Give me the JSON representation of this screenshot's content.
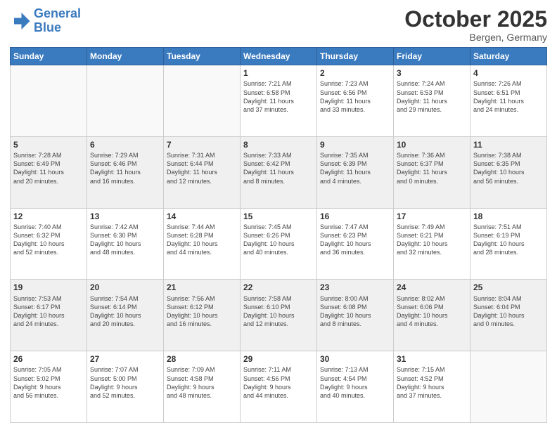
{
  "header": {
    "logo_line1": "General",
    "logo_line2": "Blue",
    "month": "October 2025",
    "location": "Bergen, Germany"
  },
  "weekdays": [
    "Sunday",
    "Monday",
    "Tuesday",
    "Wednesday",
    "Thursday",
    "Friday",
    "Saturday"
  ],
  "weeks": [
    [
      {
        "day": "",
        "info": ""
      },
      {
        "day": "",
        "info": ""
      },
      {
        "day": "",
        "info": ""
      },
      {
        "day": "1",
        "info": "Sunrise: 7:21 AM\nSunset: 6:58 PM\nDaylight: 11 hours\nand 37 minutes."
      },
      {
        "day": "2",
        "info": "Sunrise: 7:23 AM\nSunset: 6:56 PM\nDaylight: 11 hours\nand 33 minutes."
      },
      {
        "day": "3",
        "info": "Sunrise: 7:24 AM\nSunset: 6:53 PM\nDaylight: 11 hours\nand 29 minutes."
      },
      {
        "day": "4",
        "info": "Sunrise: 7:26 AM\nSunset: 6:51 PM\nDaylight: 11 hours\nand 24 minutes."
      }
    ],
    [
      {
        "day": "5",
        "info": "Sunrise: 7:28 AM\nSunset: 6:49 PM\nDaylight: 11 hours\nand 20 minutes."
      },
      {
        "day": "6",
        "info": "Sunrise: 7:29 AM\nSunset: 6:46 PM\nDaylight: 11 hours\nand 16 minutes."
      },
      {
        "day": "7",
        "info": "Sunrise: 7:31 AM\nSunset: 6:44 PM\nDaylight: 11 hours\nand 12 minutes."
      },
      {
        "day": "8",
        "info": "Sunrise: 7:33 AM\nSunset: 6:42 PM\nDaylight: 11 hours\nand 8 minutes."
      },
      {
        "day": "9",
        "info": "Sunrise: 7:35 AM\nSunset: 6:39 PM\nDaylight: 11 hours\nand 4 minutes."
      },
      {
        "day": "10",
        "info": "Sunrise: 7:36 AM\nSunset: 6:37 PM\nDaylight: 11 hours\nand 0 minutes."
      },
      {
        "day": "11",
        "info": "Sunrise: 7:38 AM\nSunset: 6:35 PM\nDaylight: 10 hours\nand 56 minutes."
      }
    ],
    [
      {
        "day": "12",
        "info": "Sunrise: 7:40 AM\nSunset: 6:32 PM\nDaylight: 10 hours\nand 52 minutes."
      },
      {
        "day": "13",
        "info": "Sunrise: 7:42 AM\nSunset: 6:30 PM\nDaylight: 10 hours\nand 48 minutes."
      },
      {
        "day": "14",
        "info": "Sunrise: 7:44 AM\nSunset: 6:28 PM\nDaylight: 10 hours\nand 44 minutes."
      },
      {
        "day": "15",
        "info": "Sunrise: 7:45 AM\nSunset: 6:26 PM\nDaylight: 10 hours\nand 40 minutes."
      },
      {
        "day": "16",
        "info": "Sunrise: 7:47 AM\nSunset: 6:23 PM\nDaylight: 10 hours\nand 36 minutes."
      },
      {
        "day": "17",
        "info": "Sunrise: 7:49 AM\nSunset: 6:21 PM\nDaylight: 10 hours\nand 32 minutes."
      },
      {
        "day": "18",
        "info": "Sunrise: 7:51 AM\nSunset: 6:19 PM\nDaylight: 10 hours\nand 28 minutes."
      }
    ],
    [
      {
        "day": "19",
        "info": "Sunrise: 7:53 AM\nSunset: 6:17 PM\nDaylight: 10 hours\nand 24 minutes."
      },
      {
        "day": "20",
        "info": "Sunrise: 7:54 AM\nSunset: 6:14 PM\nDaylight: 10 hours\nand 20 minutes."
      },
      {
        "day": "21",
        "info": "Sunrise: 7:56 AM\nSunset: 6:12 PM\nDaylight: 10 hours\nand 16 minutes."
      },
      {
        "day": "22",
        "info": "Sunrise: 7:58 AM\nSunset: 6:10 PM\nDaylight: 10 hours\nand 12 minutes."
      },
      {
        "day": "23",
        "info": "Sunrise: 8:00 AM\nSunset: 6:08 PM\nDaylight: 10 hours\nand 8 minutes."
      },
      {
        "day": "24",
        "info": "Sunrise: 8:02 AM\nSunset: 6:06 PM\nDaylight: 10 hours\nand 4 minutes."
      },
      {
        "day": "25",
        "info": "Sunrise: 8:04 AM\nSunset: 6:04 PM\nDaylight: 10 hours\nand 0 minutes."
      }
    ],
    [
      {
        "day": "26",
        "info": "Sunrise: 7:05 AM\nSunset: 5:02 PM\nDaylight: 9 hours\nand 56 minutes."
      },
      {
        "day": "27",
        "info": "Sunrise: 7:07 AM\nSunset: 5:00 PM\nDaylight: 9 hours\nand 52 minutes."
      },
      {
        "day": "28",
        "info": "Sunrise: 7:09 AM\nSunset: 4:58 PM\nDaylight: 9 hours\nand 48 minutes."
      },
      {
        "day": "29",
        "info": "Sunrise: 7:11 AM\nSunset: 4:56 PM\nDaylight: 9 hours\nand 44 minutes."
      },
      {
        "day": "30",
        "info": "Sunrise: 7:13 AM\nSunset: 4:54 PM\nDaylight: 9 hours\nand 40 minutes."
      },
      {
        "day": "31",
        "info": "Sunrise: 7:15 AM\nSunset: 4:52 PM\nDaylight: 9 hours\nand 37 minutes."
      },
      {
        "day": "",
        "info": ""
      }
    ]
  ]
}
